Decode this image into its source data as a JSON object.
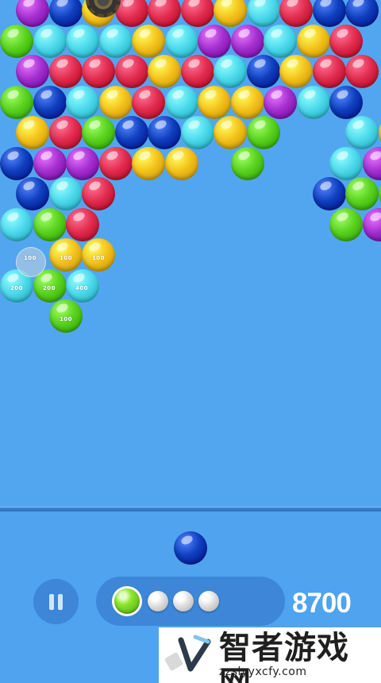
{
  "game": {
    "colors": {
      "purple": "#a32fcf",
      "blue": "#0f3fbd",
      "yellow": "#f4c21b",
      "cyan": "#4dd9ec",
      "red": "#e12c4f",
      "green": "#5ad21e",
      "background": "#52a6ef",
      "panel": "#3d86d8"
    },
    "score": "8700",
    "pause_icon": "pause-icon",
    "queue": {
      "current_color": "green",
      "remaining_count": 3
    },
    "popup_points": [
      "100",
      "100",
      "100",
      "200",
      "400",
      "100",
      "200"
    ]
  },
  "watermark": {
    "title": "智者游戏网",
    "url": "zzslyyxcfy.com",
    "logo_icon": "brand-logo-icon"
  }
}
